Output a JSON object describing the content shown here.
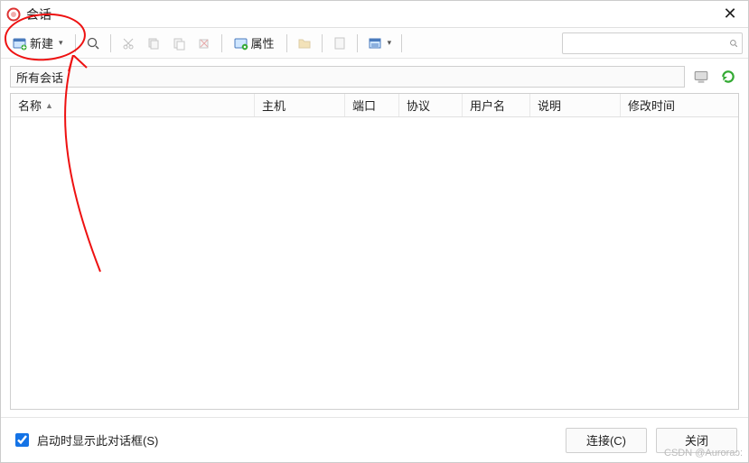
{
  "title": "会话",
  "toolbar": {
    "new_label": "新建",
    "prop_label": "属性"
  },
  "path": "所有会话",
  "columns": {
    "name": "名称",
    "host": "主机",
    "port": "端口",
    "proto": "协议",
    "user": "用户名",
    "desc": "说明",
    "mtime": "修改时间"
  },
  "checkbox_label": "启动时显示此对话框(S)",
  "buttons": {
    "connect": "连接(C)",
    "close": "关闭"
  },
  "watermark": "CSDN @Auroraɔ:"
}
